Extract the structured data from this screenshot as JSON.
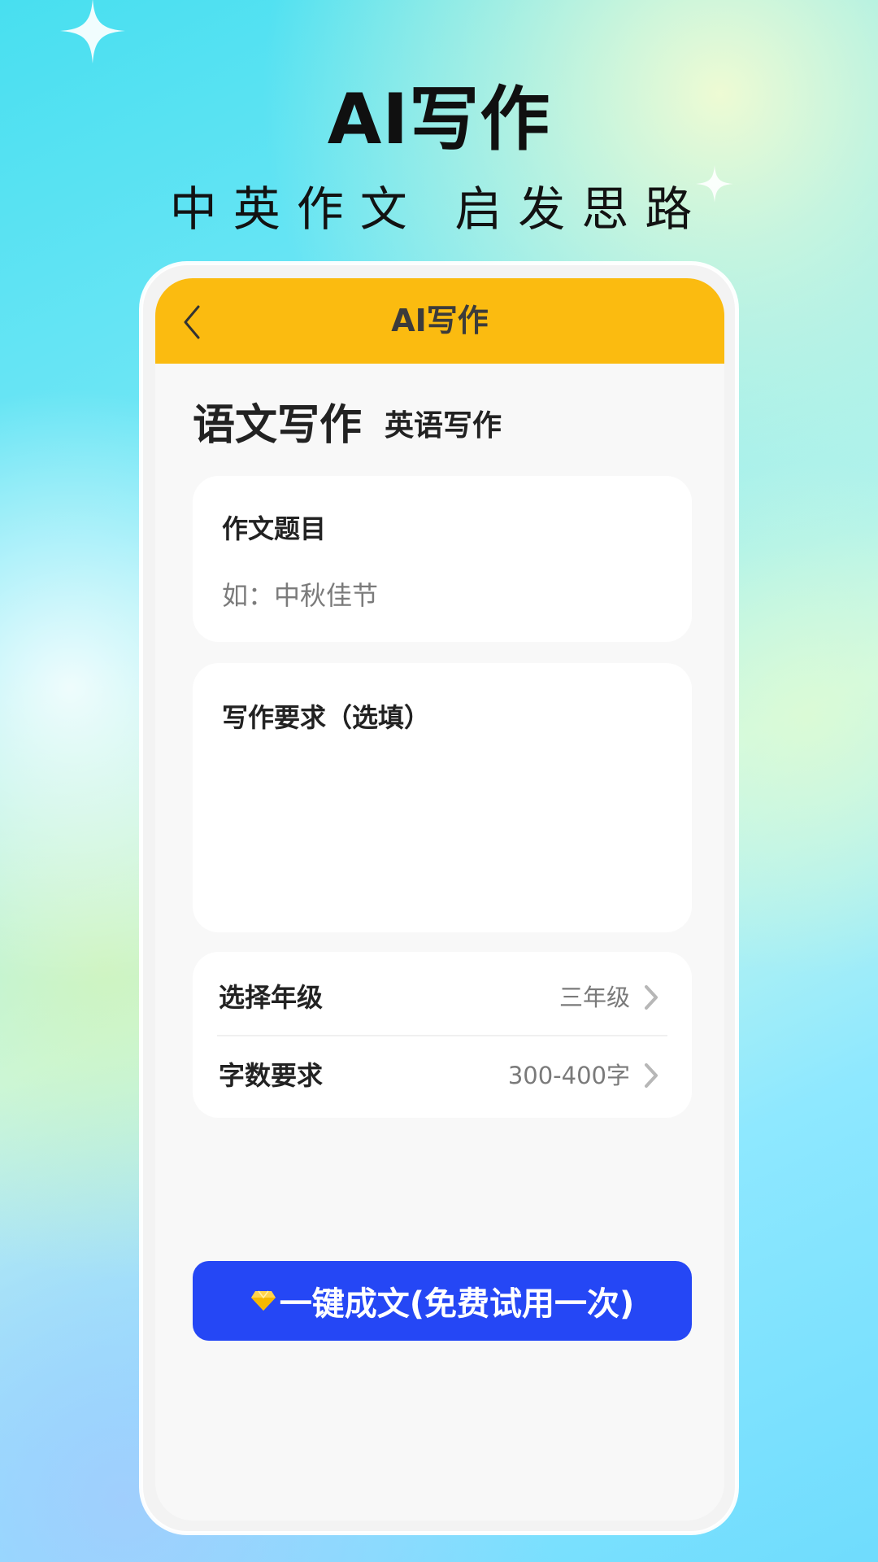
{
  "promo": {
    "headline": "AI写作",
    "subheadline": "中英作文 启发思路"
  },
  "app": {
    "header_title": "AI写作",
    "back_icon": "back-chevron-icon"
  },
  "tabs": {
    "active": "语文写作",
    "inactive": "英语写作"
  },
  "topic": {
    "label": "作文题目",
    "placeholder": "如：中秋佳节"
  },
  "requirements": {
    "label": "写作要求（选填）",
    "value": ""
  },
  "settings": {
    "grade": {
      "label": "选择年级",
      "value": "三年级"
    },
    "word_count": {
      "label": "字数要求",
      "value": "300-400字"
    }
  },
  "generate_button": {
    "label": "一键成文(免费试用一次)",
    "icon": "diamond-icon"
  },
  "colors": {
    "header": "#fbbb10",
    "primary_button": "#2547f5",
    "card": "#ffffff",
    "screen_background": "#f8f8f8"
  }
}
